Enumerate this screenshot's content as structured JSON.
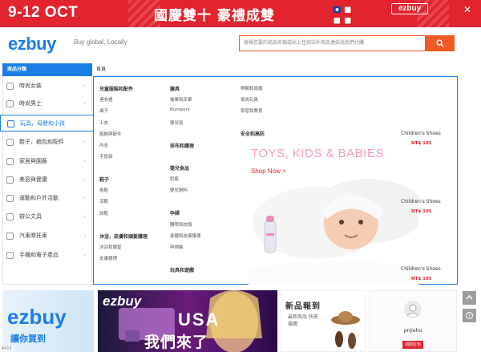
{
  "promo": {
    "date": "9-12 OCT",
    "slogan": "國慶雙十  豪禮成雙",
    "brand": "ezbuy"
  },
  "header": {
    "logo": "ezbuy",
    "tagline": "Buy global, Locally",
    "search_placeholder": "搜尋您要的商品名稱或貼上任何站外商品連結找我們代購"
  },
  "nav": {
    "category_heading": "商品分類",
    "home": "首頁"
  },
  "sidebar": {
    "items": [
      {
        "label": "時尚女裝",
        "icon": "dress-icon"
      },
      {
        "label": "時尚男士",
        "icon": "shirt-icon"
      },
      {
        "label": "玩具，母嬰和小孩",
        "icon": "baby-bottle-icon",
        "active": true
      },
      {
        "label": "鞋子，箱包和配件",
        "icon": "shoe-icon"
      },
      {
        "label": "家居與園藝",
        "icon": "house-icon"
      },
      {
        "label": "美容與健康",
        "icon": "lipstick-icon"
      },
      {
        "label": "運動和戶外活動",
        "icon": "sport-icon"
      },
      {
        "label": "辦公文具",
        "icon": "pen-icon"
      },
      {
        "label": "汽車摩托車",
        "icon": "car-icon"
      },
      {
        "label": "手機和電子產品",
        "icon": "phone-icon"
      }
    ]
  },
  "panel": {
    "col1": {
      "heading": "兒童服裝和配件",
      "items": [
        "連衣裙",
        "褲子",
        "上衣",
        "服飾與配件",
        "內衣",
        "手提袋"
      ],
      "heading2": "鞋子",
      "items2": [
        "拖鞋",
        "涼鞋",
        "球鞋"
      ],
      "heading3": "沐浴，皮膚和頭髮護理",
      "items3": [
        "沐浴和護髮",
        "皮膚護理"
      ]
    },
    "col2": {
      "heading": "寢具",
      "items": [
        "被單和床單",
        "Bumpers",
        "嬰兒毯"
      ],
      "heading2": "尿布和護理",
      "heading3": "嬰兒食品",
      "items3": [
        "奶瓶",
        "嬰兒飼料"
      ],
      "heading4": "孕婦",
      "items4": [
        "腰帶和枕頭",
        "身體和皮膚護理",
        "孕婦裝"
      ],
      "heading5": "玩具和遊戲"
    },
    "col3": {
      "items": [
        "棋類和遊戲",
        "填充玩具",
        "學習和教育"
      ],
      "heading": "安全和高防"
    },
    "hero": {
      "title": "TOYS, KIDS & BABIES",
      "cta": "Shop Now >"
    },
    "products": [
      {
        "name": "Children's Shoes",
        "price": "NT$ 105"
      },
      {
        "name": "Children's Shoes",
        "price": "NT$ 105"
      },
      {
        "name": "Children's Shoes",
        "price": "NT$ 105"
      }
    ]
  },
  "banners": {
    "b1_logo": "ezbuy",
    "b1_sub": "讓你買到",
    "b2_brand": "ezbuy",
    "b2_usa": "USA",
    "b2_slogan": "我們來了",
    "b3_title": "新品報到",
    "b3_sub": "最新商品 快來搶購",
    "b4_user": "pnjiehu",
    "b4_btn": "領取紅包"
  },
  "status_text": "6415"
}
